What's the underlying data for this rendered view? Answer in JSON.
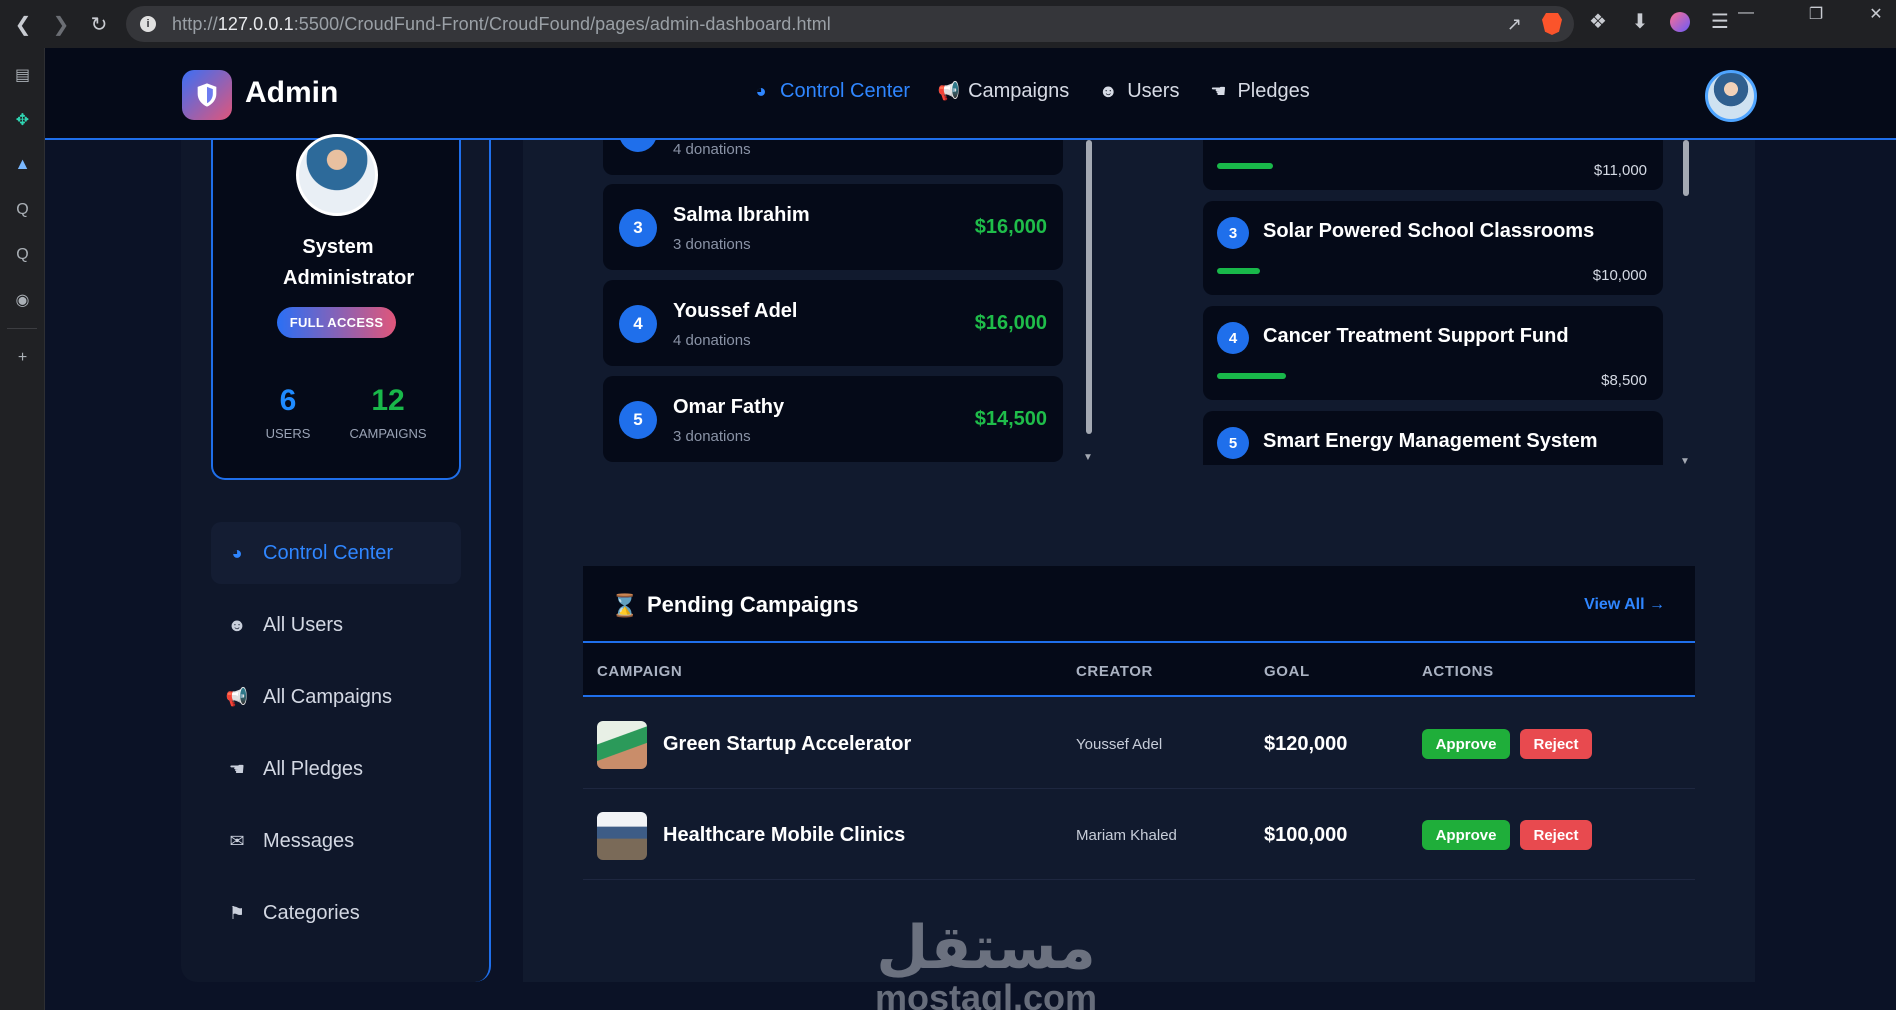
{
  "browser": {
    "url_prefix": "http://",
    "url_host": "127.0.0.1",
    "url_rest": ":5500/CroudFund-Front/CroudFound/pages/admin-dashboard.html"
  },
  "nav": {
    "brand": "Admin",
    "items": [
      {
        "label": "Control Center",
        "icon": "dashboard-icon"
      },
      {
        "label": "Campaigns",
        "icon": "megaphone-icon"
      },
      {
        "label": "Users",
        "icon": "users-icon"
      },
      {
        "label": "Pledges",
        "icon": "hand-donate-icon"
      }
    ]
  },
  "profile": {
    "name": "System Administrator",
    "badge": "FULL ACCESS",
    "users_count": "6",
    "users_label": "USERS",
    "campaigns_count": "12",
    "campaigns_label": "CAMPAIGNS"
  },
  "sidebar": {
    "items": [
      {
        "label": "Control Center",
        "icon": "dashboard-icon"
      },
      {
        "label": "All Users",
        "icon": "users-icon"
      },
      {
        "label": "All Campaigns",
        "icon": "megaphone-icon"
      },
      {
        "label": "All Pledges",
        "icon": "hand-donate-icon"
      },
      {
        "label": "Messages",
        "icon": "comments-icon"
      },
      {
        "label": "Categories",
        "icon": "tags-icon"
      }
    ]
  },
  "top_donors": [
    {
      "rank": "",
      "name": "",
      "sub": "4 donations",
      "amount": ""
    },
    {
      "rank": "3",
      "name": "Salma Ibrahim",
      "sub": "3 donations",
      "amount": "$16,000"
    },
    {
      "rank": "4",
      "name": "Youssef Adel",
      "sub": "4 donations",
      "amount": "$16,000"
    },
    {
      "rank": "5",
      "name": "Omar Fathy",
      "sub": "3 donations",
      "amount": "$14,500"
    }
  ],
  "top_campaigns": [
    {
      "rank": "",
      "name": "",
      "amount": "$11,000",
      "progress": 0.13
    },
    {
      "rank": "3",
      "name": "Solar Powered School Classrooms",
      "amount": "$10,000",
      "progress": 0.1
    },
    {
      "rank": "4",
      "name": "Cancer Treatment Support Fund",
      "amount": "$8,500",
      "progress": 0.16
    },
    {
      "rank": "5",
      "name": "Smart Energy Management System",
      "amount": "",
      "progress": 0
    }
  ],
  "pending": {
    "title": "Pending Campaigns",
    "view_all": "View All →",
    "columns": [
      "CAMPAIGN",
      "CREATOR",
      "GOAL",
      "ACTIONS"
    ],
    "rows": [
      {
        "name": "Green Startup Accelerator",
        "creator": "Youssef Adel",
        "goal": "$120,000",
        "approve": "Approve",
        "reject": "Reject"
      },
      {
        "name": "Healthcare Mobile Clinics",
        "creator": "Mariam Khaled",
        "goal": "$100,000",
        "approve": "Approve",
        "reject": "Reject"
      }
    ]
  },
  "watermark": {
    "arabic": "مستقل",
    "latin": "mostaql.com"
  },
  "colors": {
    "accent": "#1f6feb",
    "success": "#1fbd4a",
    "danger": "#e84a4f"
  }
}
